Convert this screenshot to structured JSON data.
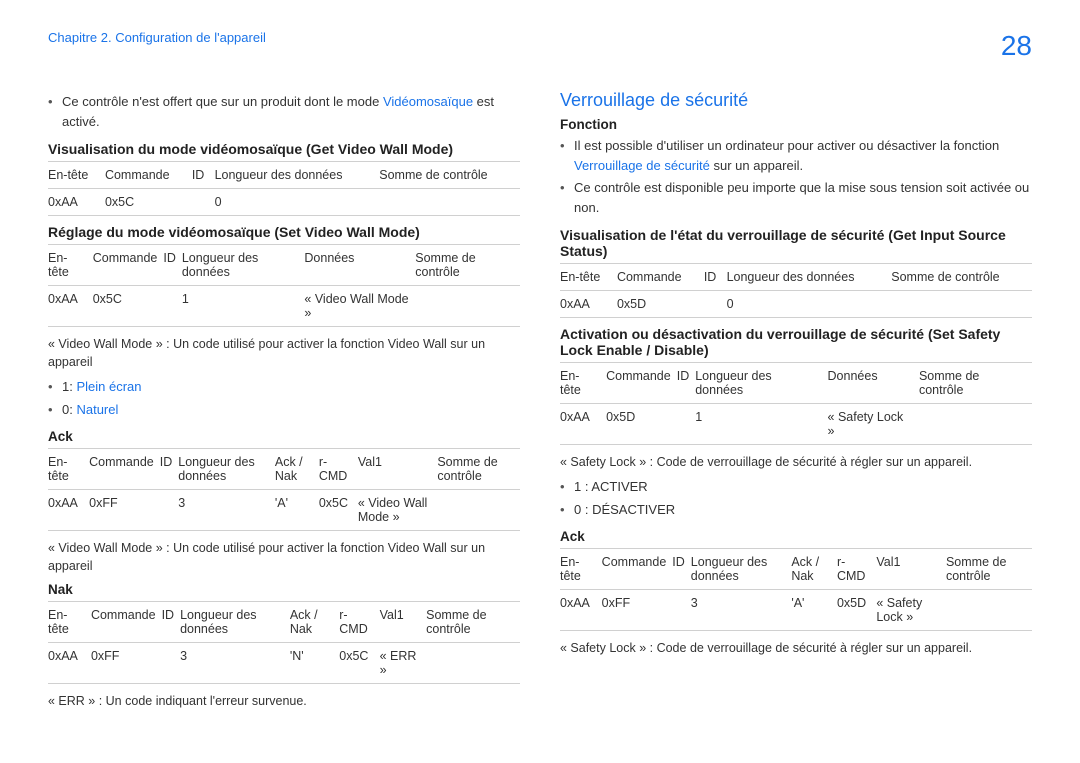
{
  "header": {
    "chapter": "Chapitre 2. Configuration de l'appareil",
    "page": "28"
  },
  "left": {
    "intro_pre": "Ce contrôle n'est offert que sur un produit dont le mode ",
    "intro_link": "Vidéomosaïque",
    "intro_post": " est activé.",
    "vis_title": "Visualisation du mode vidéomosaïque (Get Video Wall Mode)",
    "table1": {
      "h": [
        "En-tête",
        "Commande",
        "ID",
        "Longueur des données",
        "Somme de contrôle"
      ],
      "r": [
        "0xAA",
        "0x5C",
        "",
        "0",
        ""
      ]
    },
    "set_title": "Réglage du mode vidéomosaïque (Set Video Wall Mode)",
    "table2": {
      "h": [
        "En-tête",
        "Commande",
        "ID",
        "Longueur des données",
        "Données",
        "Somme de contrôle"
      ],
      "r": [
        "0xAA",
        "0x5C",
        "",
        "1",
        "« Video Wall Mode »",
        ""
      ]
    },
    "note1": "« Video Wall Mode » : Un code utilisé pour activer la fonction Video Wall sur un appareil",
    "b1_pre": "1: ",
    "b1_link": "Plein écran",
    "b2_pre": "0: ",
    "b2_link": "Naturel",
    "ack_title": "Ack",
    "table3": {
      "h": [
        "En-tête",
        "Commande",
        "ID",
        "Longueur des données",
        "Ack / Nak",
        "r-CMD",
        "Val1",
        "Somme de contrôle"
      ],
      "r": [
        "0xAA",
        "0xFF",
        "",
        "3",
        "'A'",
        "0x5C",
        "« Video Wall Mode »",
        ""
      ]
    },
    "note2": "« Video Wall Mode » : Un code utilisé pour activer la fonction Video Wall sur un appareil",
    "nak_title": "Nak",
    "table4": {
      "h": [
        "En-tête",
        "Commande",
        "ID",
        "Longueur des données",
        "Ack / Nak",
        "r-CMD",
        "Val1",
        "Somme de contrôle"
      ],
      "r": [
        "0xAA",
        "0xFF",
        "",
        "3",
        "'N'",
        "0x5C",
        "« ERR »",
        ""
      ]
    },
    "note3": "« ERR » : Un code indiquant l'erreur survenue."
  },
  "right": {
    "main_title": "Verrouillage de sécurité",
    "func_title": "Fonction",
    "b1_pre": "Il est possible d'utiliser un ordinateur pour activer ou désactiver la fonction ",
    "b1_link": "Verrouillage de sécurité",
    "b1_post": " sur un appareil.",
    "b2": "Ce contrôle est disponible peu importe que la mise sous tension soit activée ou non.",
    "vis_title": "Visualisation de l'état du verrouillage de sécurité (Get Input Source Status)",
    "table1": {
      "h": [
        "En-tête",
        "Commande",
        "ID",
        "Longueur des données",
        "Somme de contrôle"
      ],
      "r": [
        "0xAA",
        "0x5D",
        "",
        "0",
        ""
      ]
    },
    "set_title": "Activation ou désactivation du verrouillage de sécurité (Set Safety Lock Enable / Disable)",
    "table2": {
      "h": [
        "En-tête",
        "Commande",
        "ID",
        "Longueur des données",
        "Données",
        "Somme de contrôle"
      ],
      "r": [
        "0xAA",
        "0x5D",
        "",
        "1",
        "« Safety Lock »",
        ""
      ]
    },
    "note1": "« Safety Lock » : Code de verrouillage de sécurité à régler sur un appareil.",
    "b3": "1 : ACTIVER",
    "b4": "0 : DÉSACTIVER",
    "ack_title": "Ack",
    "table3": {
      "h": [
        "En-tête",
        "Commande",
        "ID",
        "Longueur des données",
        "Ack / Nak",
        "r-CMD",
        "Val1",
        "Somme de contrôle"
      ],
      "r": [
        "0xAA",
        "0xFF",
        "",
        "3",
        "'A'",
        "0x5D",
        "« Safety Lock »",
        ""
      ]
    },
    "note2": "« Safety Lock » : Code de verrouillage de sécurité à régler sur un appareil."
  }
}
